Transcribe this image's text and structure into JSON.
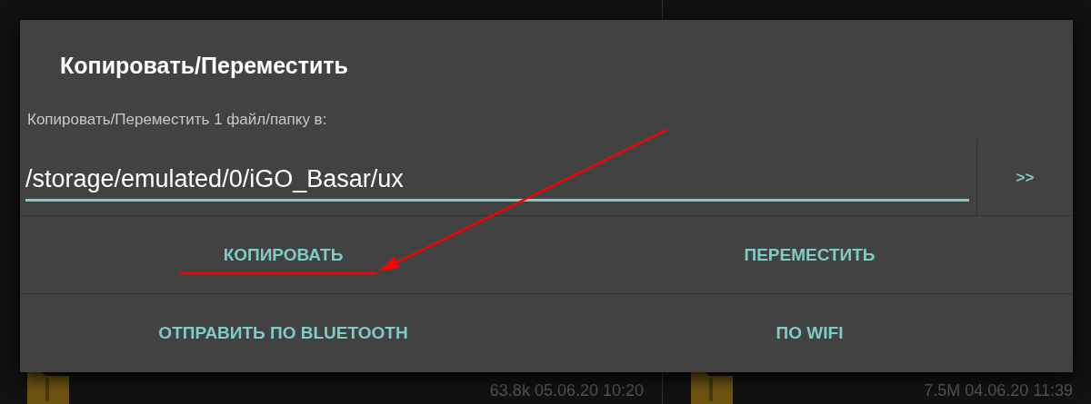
{
  "background_files": [
    {
      "meta": "63.8k  05.06.20  10:20"
    },
    {
      "meta": "7.5M  04.06.20  11:39"
    }
  ],
  "dialog": {
    "title": "Копировать/Переместить",
    "prompt": "Копировать/Переместить 1 файл/папку в:",
    "path_value": "/storage/emulated/0/iGO_Basar/ux",
    "browse_button": ">>",
    "actions": [
      [
        "КОПИРОВАТЬ",
        "ПЕРЕМЕСТИТЬ"
      ],
      [
        "ОТПРАВИТЬ ПО BLUETOOTH",
        "ПО WIFI"
      ]
    ]
  },
  "annotation": {
    "kind": "arrow"
  }
}
